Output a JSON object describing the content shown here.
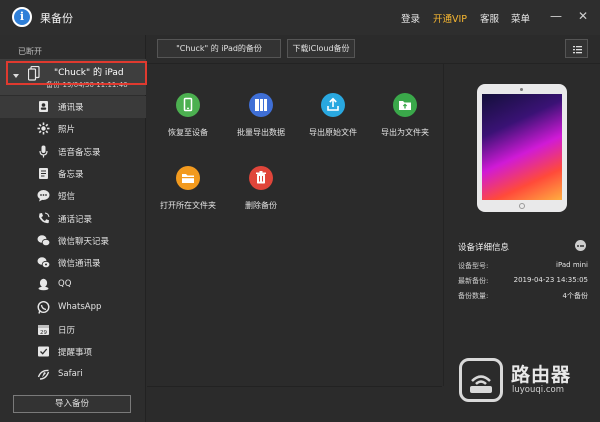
{
  "app": {
    "title": "果备份",
    "logo_letter": "i"
  },
  "top_menu": {
    "login": "登录",
    "vip": "开通VIP",
    "service": "客服",
    "menu": "菜单"
  },
  "window": {
    "minimize": "—",
    "close": "✕"
  },
  "sidebar": {
    "section_label": "已断开",
    "device": {
      "name": "\"Chuck\" 的 iPad",
      "backup_date": "备份-19/04/30 11:11:46"
    },
    "items": [
      {
        "label": "通讯录",
        "icon": "contacts-icon"
      },
      {
        "label": "照片",
        "icon": "photos-icon"
      },
      {
        "label": "语音备忘录",
        "icon": "microphone-icon"
      },
      {
        "label": "备忘录",
        "icon": "notes-icon"
      },
      {
        "label": "短信",
        "icon": "message-icon"
      },
      {
        "label": "通话记录",
        "icon": "phone-icon"
      },
      {
        "label": "微信聊天记录",
        "icon": "wechat-icon"
      },
      {
        "label": "微信通讯录",
        "icon": "wechat-contacts-icon"
      },
      {
        "label": "QQ",
        "icon": "qq-icon"
      },
      {
        "label": "WhatsApp",
        "icon": "whatsapp-icon"
      },
      {
        "label": "日历",
        "icon": "calendar-icon"
      },
      {
        "label": "提醒事项",
        "icon": "reminder-icon"
      },
      {
        "label": "Safari",
        "icon": "safari-icon"
      }
    ],
    "selected_index": 0,
    "import_button": "导入备份"
  },
  "toolbar": {
    "backup_tab": "\"Chuck\" 的 iPad的备份",
    "download_icloud": "下载iCloud备份"
  },
  "actions": [
    {
      "label": "恢复至设备",
      "color": "#4cb050",
      "icon": "restore-device-icon"
    },
    {
      "label": "批量导出数据",
      "color": "#3f6fd6",
      "icon": "batch-export-icon"
    },
    {
      "label": "导出原始文件",
      "color": "#29a8e0",
      "icon": "export-raw-icon"
    },
    {
      "label": "导出为文件夹",
      "color": "#3aa84a",
      "icon": "export-folder-icon"
    },
    {
      "label": "打开所在文件夹",
      "color": "#f29a1e",
      "icon": "open-folder-icon"
    },
    {
      "label": "删除备份",
      "color": "#e0453a",
      "icon": "trash-icon"
    }
  ],
  "details": {
    "title": "设备详细信息",
    "rows": [
      {
        "key": "设备型号:",
        "value": "iPad mini"
      },
      {
        "key": "最新备份:",
        "value": "2019-04-23 14:35:05"
      },
      {
        "key": "备份数量:",
        "value": "4个备份"
      }
    ]
  },
  "watermark": {
    "brand": "路由器",
    "site": "luyouqi.com"
  }
}
